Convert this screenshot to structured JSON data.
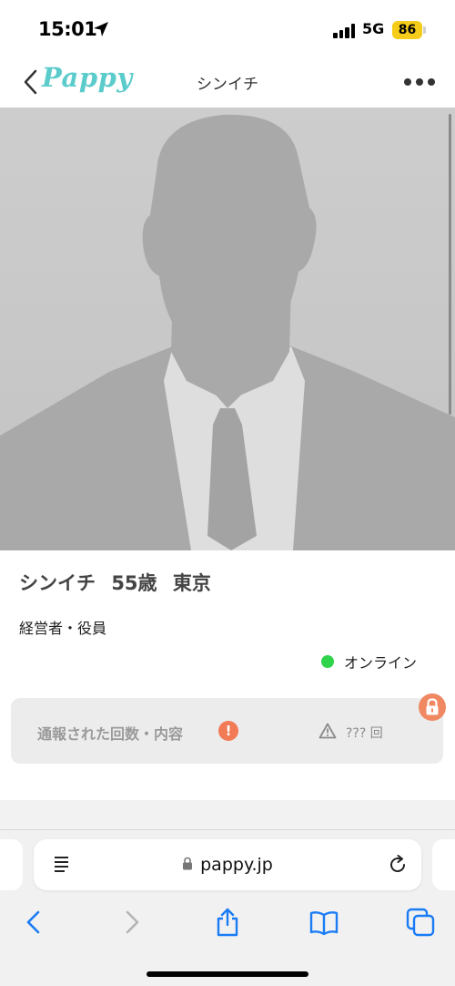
{
  "status_bar": {
    "time": "15:01",
    "network": "5G",
    "battery": "86"
  },
  "nav": {
    "logo": "Pappy",
    "title": "シンイチ"
  },
  "profile": {
    "name": "シンイチ",
    "age": "55歳",
    "location": "東京",
    "occupation": "経営者・役員",
    "status": "オンライン",
    "status_color": "#2fd44a"
  },
  "report": {
    "label": "通報された回数・内容",
    "alert_glyph": "!",
    "count": "??? 回",
    "accent_color": "#f27a55"
  },
  "browser": {
    "url": "pappy.jp"
  },
  "icons": [
    "back-chevron-icon",
    "location-arrow-icon",
    "signal-icon",
    "more-icon",
    "alert-icon",
    "warning-icon",
    "lock-icon",
    "reader-icon",
    "reload-icon",
    "back-icon",
    "forward-icon",
    "share-icon",
    "bookmarks-icon",
    "tabs-icon"
  ],
  "colors": {
    "brand": "#5ccbcb",
    "battery": "#f5cc1a",
    "ios_blue": "#1a7cf5"
  }
}
